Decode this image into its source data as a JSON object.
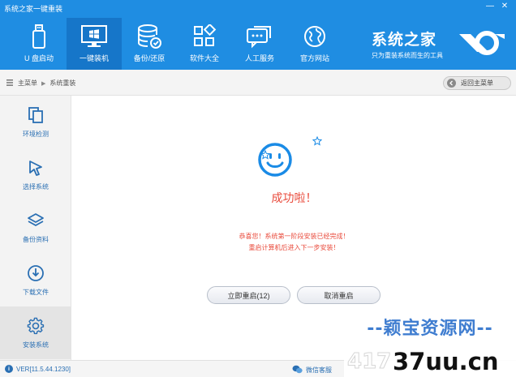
{
  "window": {
    "title": "系统之家一键重装",
    "minimize_glyph": "—",
    "close_glyph": "✕"
  },
  "nav": {
    "items": [
      {
        "label": "U 盘启动",
        "icon": "usb-drive-icon"
      },
      {
        "label": "一键装机",
        "icon": "windows-monitor-icon",
        "active": true
      },
      {
        "label": "备份/还原",
        "icon": "database-backup-icon"
      },
      {
        "label": "软件大全",
        "icon": "app-grid-icon"
      },
      {
        "label": "人工服务",
        "icon": "chat-bubble-icon"
      },
      {
        "label": "官方网站",
        "icon": "globe-icon"
      }
    ]
  },
  "brand": {
    "title": "系统之家",
    "subtitle": "只为重装系统而生的工具"
  },
  "breadcrumb": {
    "home": "主菜单",
    "current": "系统重装"
  },
  "back_button": {
    "label": "返回主菜单"
  },
  "sidebar": {
    "items": [
      {
        "label": "环境检测",
        "icon": "copy-docs-icon"
      },
      {
        "label": "选择系统",
        "icon": "cursor-arrow-icon"
      },
      {
        "label": "备份资料",
        "icon": "layers-icon"
      },
      {
        "label": "下载文件",
        "icon": "download-circle-icon"
      },
      {
        "label": "安装系统",
        "icon": "gear-icon",
        "active": true
      }
    ]
  },
  "main": {
    "success_title": "成功啦！",
    "message_line1": "恭喜您！系统第一阶段安装已经完成！",
    "message_line2": "重启计算机后进入下一步安装！",
    "restart_button": "立即重启(12)",
    "cancel_button": "取消重启"
  },
  "statusbar": {
    "version": "VER[11.5.44.1230]",
    "wechat": "微信客服"
  },
  "watermark": {
    "line1": "--颖宝资源网--",
    "line2_prefix": "417",
    "line2_main": "37uu.cn"
  },
  "colors": {
    "header_blue": "#1f8de2",
    "header_active": "#1676c9",
    "accent_red": "#e94b3c",
    "link_blue": "#2a6fb3",
    "smiley_blue": "#1a8be6"
  }
}
